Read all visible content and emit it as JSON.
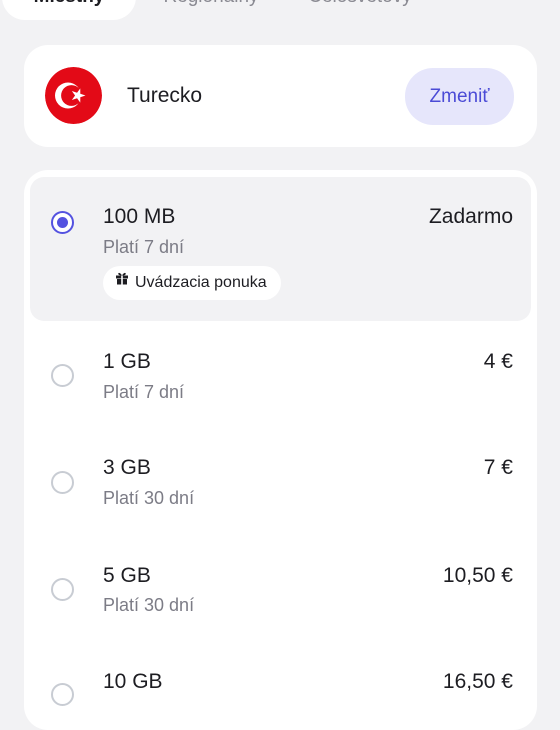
{
  "tabs": [
    {
      "label": "Miestny",
      "active": true
    },
    {
      "label": "Regionálny",
      "active": false
    },
    {
      "label": "Celosvetový",
      "active": false
    }
  ],
  "country": {
    "name": "Turecko",
    "flag_icon": "turkey-flag-icon",
    "change_label": "Zmeniť"
  },
  "plans": [
    {
      "size": "100 MB",
      "validity": "Platí 7 dní",
      "price": "Zadarmo",
      "selected": true,
      "badge": "Uvádzacia ponuka"
    },
    {
      "size": "1 GB",
      "validity": "Platí 7 dní",
      "price": "4 €",
      "selected": false
    },
    {
      "size": "3 GB",
      "validity": "Platí 30 dní",
      "price": "7 €",
      "selected": false
    },
    {
      "size": "5 GB",
      "validity": "Platí 30 dní",
      "price": "10,50 €",
      "selected": false
    },
    {
      "size": "10 GB",
      "validity": "",
      "price": "16,50 €",
      "selected": false
    }
  ],
  "colors": {
    "accent": "#5452e0",
    "button_bg": "#e6e6fb",
    "background": "#f2f2f4",
    "flag_red": "#e30a17"
  }
}
